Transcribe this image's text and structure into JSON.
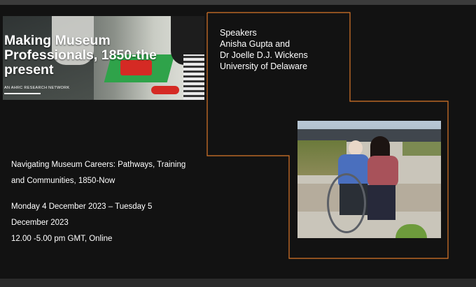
{
  "banner": {
    "title_line1": "Making Museum",
    "title_line2": "Professionals, 1850-the",
    "title_line3": "present",
    "subtitle": "AN AHRC RESEARCH NETWORK"
  },
  "speakers": {
    "heading": "Speakers",
    "names": "Anisha Gupta and",
    "names2": "Dr Joelle D.J. Wickens",
    "affiliation": "University of Delaware"
  },
  "event": {
    "title_line1": "Navigating Museum Careers: Pathways, Training",
    "title_line2": "and Communities, 1850-Now",
    "date_line1": "Monday 4 December 2023 – Tuesday 5",
    "date_line2": "December 2023",
    "time": "12.00 -5.00 pm GMT, Online"
  },
  "colors": {
    "background": "#121212",
    "outline": "#d9772a",
    "text": "#ffffff"
  }
}
